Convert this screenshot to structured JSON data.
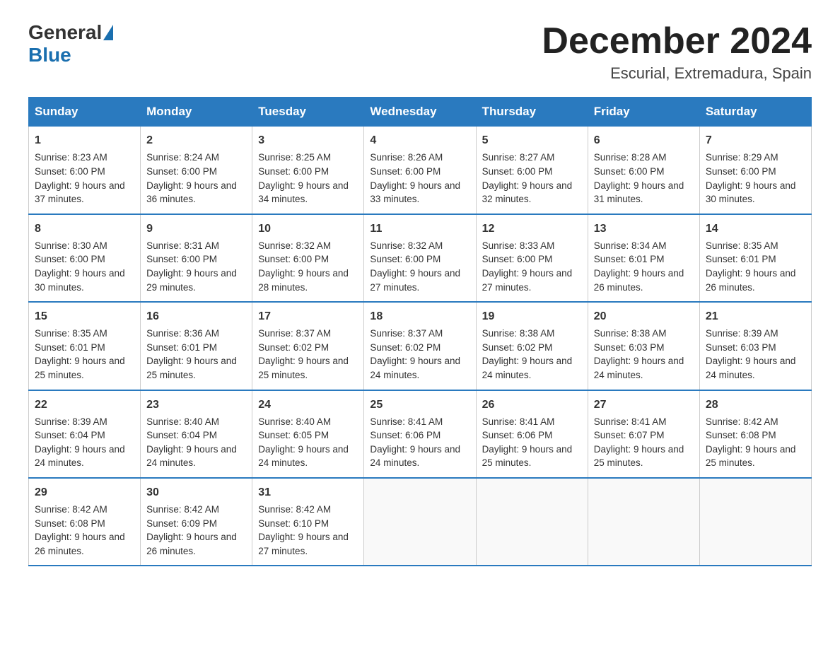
{
  "header": {
    "logo_general": "General",
    "logo_blue": "Blue",
    "month_title": "December 2024",
    "location": "Escurial, Extremadura, Spain"
  },
  "days_of_week": [
    "Sunday",
    "Monday",
    "Tuesday",
    "Wednesday",
    "Thursday",
    "Friday",
    "Saturday"
  ],
  "weeks": [
    [
      {
        "day": 1,
        "sunrise": "8:23 AM",
        "sunset": "6:00 PM",
        "daylight": "9 hours and 37 minutes."
      },
      {
        "day": 2,
        "sunrise": "8:24 AM",
        "sunset": "6:00 PM",
        "daylight": "9 hours and 36 minutes."
      },
      {
        "day": 3,
        "sunrise": "8:25 AM",
        "sunset": "6:00 PM",
        "daylight": "9 hours and 34 minutes."
      },
      {
        "day": 4,
        "sunrise": "8:26 AM",
        "sunset": "6:00 PM",
        "daylight": "9 hours and 33 minutes."
      },
      {
        "day": 5,
        "sunrise": "8:27 AM",
        "sunset": "6:00 PM",
        "daylight": "9 hours and 32 minutes."
      },
      {
        "day": 6,
        "sunrise": "8:28 AM",
        "sunset": "6:00 PM",
        "daylight": "9 hours and 31 minutes."
      },
      {
        "day": 7,
        "sunrise": "8:29 AM",
        "sunset": "6:00 PM",
        "daylight": "9 hours and 30 minutes."
      }
    ],
    [
      {
        "day": 8,
        "sunrise": "8:30 AM",
        "sunset": "6:00 PM",
        "daylight": "9 hours and 30 minutes."
      },
      {
        "day": 9,
        "sunrise": "8:31 AM",
        "sunset": "6:00 PM",
        "daylight": "9 hours and 29 minutes."
      },
      {
        "day": 10,
        "sunrise": "8:32 AM",
        "sunset": "6:00 PM",
        "daylight": "9 hours and 28 minutes."
      },
      {
        "day": 11,
        "sunrise": "8:32 AM",
        "sunset": "6:00 PM",
        "daylight": "9 hours and 27 minutes."
      },
      {
        "day": 12,
        "sunrise": "8:33 AM",
        "sunset": "6:00 PM",
        "daylight": "9 hours and 27 minutes."
      },
      {
        "day": 13,
        "sunrise": "8:34 AM",
        "sunset": "6:01 PM",
        "daylight": "9 hours and 26 minutes."
      },
      {
        "day": 14,
        "sunrise": "8:35 AM",
        "sunset": "6:01 PM",
        "daylight": "9 hours and 26 minutes."
      }
    ],
    [
      {
        "day": 15,
        "sunrise": "8:35 AM",
        "sunset": "6:01 PM",
        "daylight": "9 hours and 25 minutes."
      },
      {
        "day": 16,
        "sunrise": "8:36 AM",
        "sunset": "6:01 PM",
        "daylight": "9 hours and 25 minutes."
      },
      {
        "day": 17,
        "sunrise": "8:37 AM",
        "sunset": "6:02 PM",
        "daylight": "9 hours and 25 minutes."
      },
      {
        "day": 18,
        "sunrise": "8:37 AM",
        "sunset": "6:02 PM",
        "daylight": "9 hours and 24 minutes."
      },
      {
        "day": 19,
        "sunrise": "8:38 AM",
        "sunset": "6:02 PM",
        "daylight": "9 hours and 24 minutes."
      },
      {
        "day": 20,
        "sunrise": "8:38 AM",
        "sunset": "6:03 PM",
        "daylight": "9 hours and 24 minutes."
      },
      {
        "day": 21,
        "sunrise": "8:39 AM",
        "sunset": "6:03 PM",
        "daylight": "9 hours and 24 minutes."
      }
    ],
    [
      {
        "day": 22,
        "sunrise": "8:39 AM",
        "sunset": "6:04 PM",
        "daylight": "9 hours and 24 minutes."
      },
      {
        "day": 23,
        "sunrise": "8:40 AM",
        "sunset": "6:04 PM",
        "daylight": "9 hours and 24 minutes."
      },
      {
        "day": 24,
        "sunrise": "8:40 AM",
        "sunset": "6:05 PM",
        "daylight": "9 hours and 24 minutes."
      },
      {
        "day": 25,
        "sunrise": "8:41 AM",
        "sunset": "6:06 PM",
        "daylight": "9 hours and 24 minutes."
      },
      {
        "day": 26,
        "sunrise": "8:41 AM",
        "sunset": "6:06 PM",
        "daylight": "9 hours and 25 minutes."
      },
      {
        "day": 27,
        "sunrise": "8:41 AM",
        "sunset": "6:07 PM",
        "daylight": "9 hours and 25 minutes."
      },
      {
        "day": 28,
        "sunrise": "8:42 AM",
        "sunset": "6:08 PM",
        "daylight": "9 hours and 25 minutes."
      }
    ],
    [
      {
        "day": 29,
        "sunrise": "8:42 AM",
        "sunset": "6:08 PM",
        "daylight": "9 hours and 26 minutes."
      },
      {
        "day": 30,
        "sunrise": "8:42 AM",
        "sunset": "6:09 PM",
        "daylight": "9 hours and 26 minutes."
      },
      {
        "day": 31,
        "sunrise": "8:42 AM",
        "sunset": "6:10 PM",
        "daylight": "9 hours and 27 minutes."
      },
      null,
      null,
      null,
      null
    ]
  ]
}
